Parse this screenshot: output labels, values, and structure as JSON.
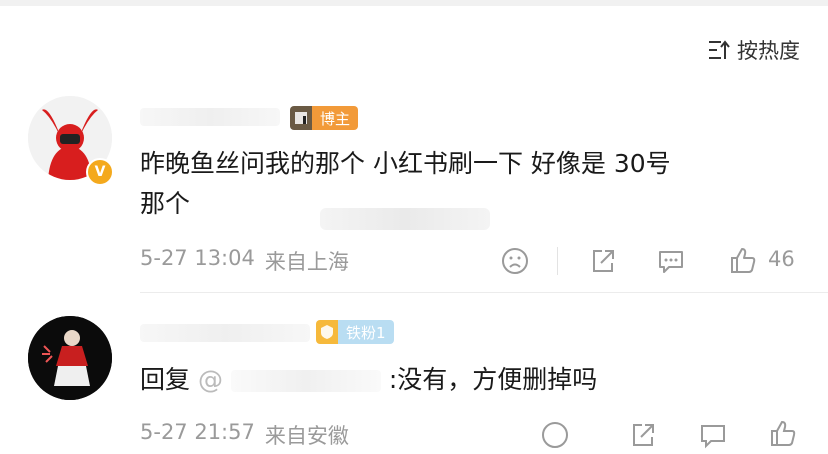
{
  "sort": {
    "label": "按热度"
  },
  "comments": [
    {
      "badge": "博主",
      "text_line1": "昨晚鱼丝问我的那个  小红书刷一下 好像是 30号",
      "text_line2": "那个",
      "time": "5-27 13:04",
      "location": "来自上海",
      "likes": "46",
      "verified": "V"
    },
    {
      "badge": "铁粉1",
      "reply_prefix": "回复",
      "reply_open": "@",
      "text": ":没有，方便删掉吗",
      "time": "5-27 21:57",
      "location": "来自安徽"
    }
  ],
  "colors": {
    "blogger_badge": "#f29a39",
    "fan_badge": "#b9ddf2",
    "meta_gray": "#9a9a9a",
    "verified": "#f4a91d"
  },
  "icons": [
    "sort-icon",
    "dislike-icon",
    "share-icon",
    "comment-icon",
    "like-icon"
  ]
}
